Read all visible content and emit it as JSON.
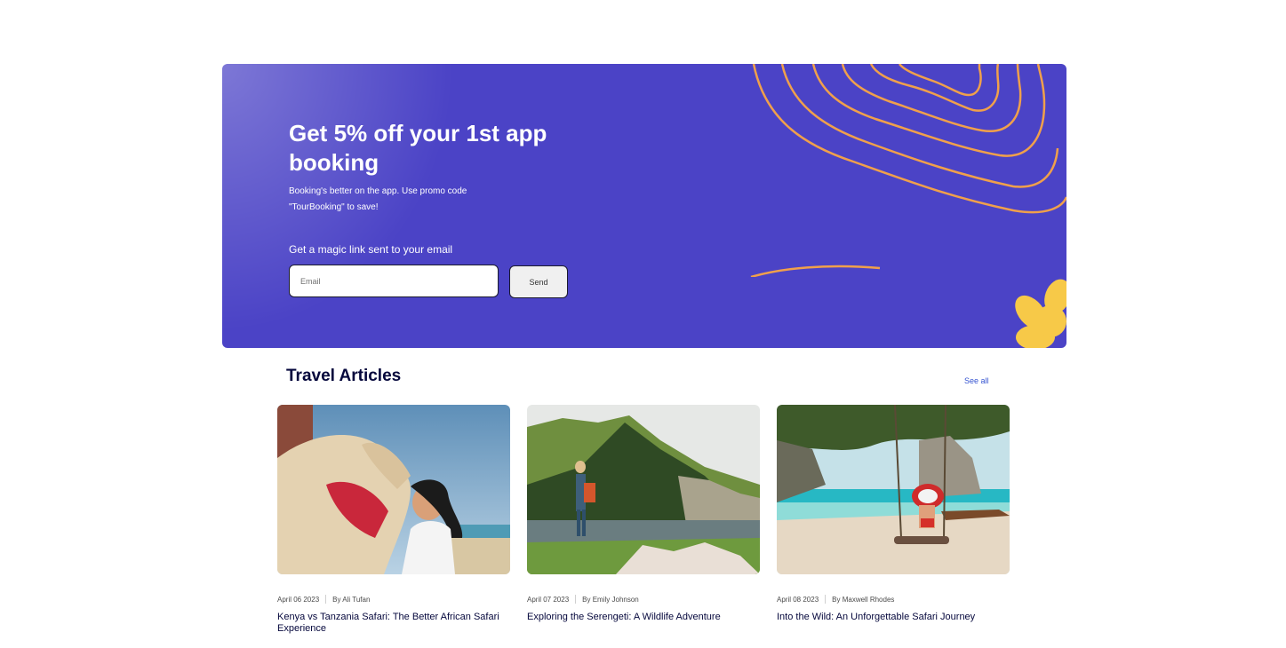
{
  "promo": {
    "title": "Get 5% off your 1st app booking",
    "description": "Booking's better on the app. Use promo code \"TourBooking\" to save!",
    "magic_link_label": "Get a magic link sent to your email",
    "email_placeholder": "Email",
    "send_label": "Send",
    "colors": {
      "background": "#4b43c6",
      "lines": "#f0a04b",
      "flower": "#f7c948"
    }
  },
  "articles": {
    "title": "Travel Articles",
    "see_all_label": "See all",
    "items": [
      {
        "date": "April 06 2023",
        "author": "By Ali Tufan",
        "title": "Kenya vs Tanzania Safari: The Better African Safari Experience",
        "image_icon": "camel-photo"
      },
      {
        "date": "April 07 2023",
        "author": "By Emily Johnson",
        "title": "Exploring the Serengeti: A Wildlife Adventure",
        "image_icon": "mountain-lake-photo"
      },
      {
        "date": "April 08 2023",
        "author": "By Maxwell Rhodes",
        "title": "Into the Wild: An Unforgettable Safari Journey",
        "image_icon": "beach-swing-photo"
      }
    ]
  }
}
